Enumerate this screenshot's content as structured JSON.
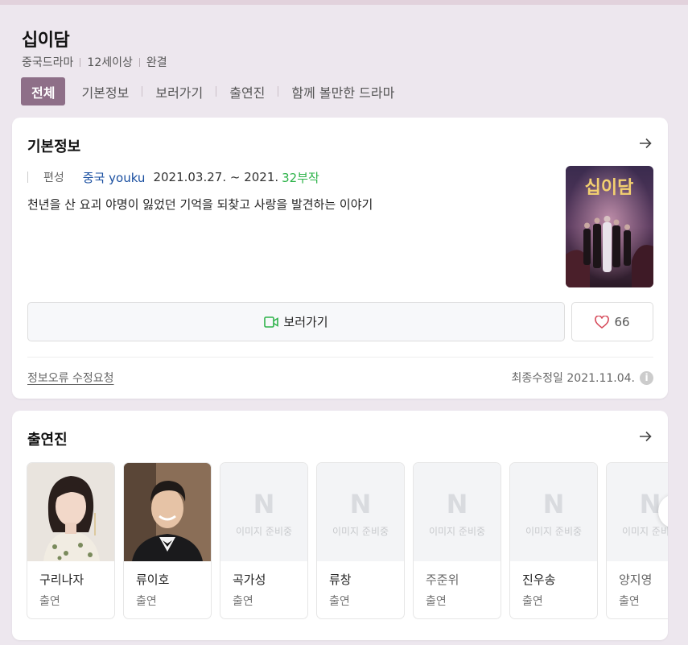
{
  "header": {
    "title": "십이담",
    "meta": [
      "중국드라마",
      "12세이상",
      "완결"
    ],
    "tabs": [
      {
        "label": "전체",
        "active": true
      },
      {
        "label": "기본정보",
        "active": false
      },
      {
        "label": "보러가기",
        "active": false
      },
      {
        "label": "출연진",
        "active": false
      },
      {
        "label": "함께 볼만한 드라마",
        "active": false
      }
    ]
  },
  "basic_info": {
    "section_title": "기본정보",
    "broadcast_label": "편성",
    "channel": "중국 youku",
    "date_range": "2021.03.27. ~ 2021.",
    "episodes": "32부작",
    "synopsis": "천년을 산 요괴 야명이 잃었던 기억을 되찾고 사랑을 발견하는 이야기",
    "poster_title": "십이담",
    "watch_label": "보러가기",
    "like_count": "66",
    "report_link": "정보오류 수정요청",
    "updated": "최종수정일 2021.11.04."
  },
  "cast": {
    "section_title": "출연진",
    "placeholder_text": "이미지 준비중",
    "placeholder_mark": "N",
    "members": [
      {
        "name": "구리나자",
        "role": "출연",
        "photo": true
      },
      {
        "name": "류이호",
        "role": "출연",
        "photo": true
      },
      {
        "name": "곡가성",
        "role": "출연",
        "photo": false
      },
      {
        "name": "류창",
        "role": "출연",
        "photo": false
      },
      {
        "name": "주준위",
        "role": "출연",
        "photo": false
      },
      {
        "name": "진우송",
        "role": "출연",
        "photo": false
      },
      {
        "name": "양지영",
        "role": "출연",
        "photo": false
      }
    ]
  },
  "colors": {
    "accent": "#8e6f88",
    "background": "#ede7ee",
    "episode_green": "#2eb34a",
    "channel_blue": "#1a4fa0"
  },
  "icons": {
    "arrow": "arrow-right-icon",
    "watch": "play-video-icon",
    "like": "heart-icon",
    "info": "info-icon",
    "next": "chevron-right-icon"
  }
}
